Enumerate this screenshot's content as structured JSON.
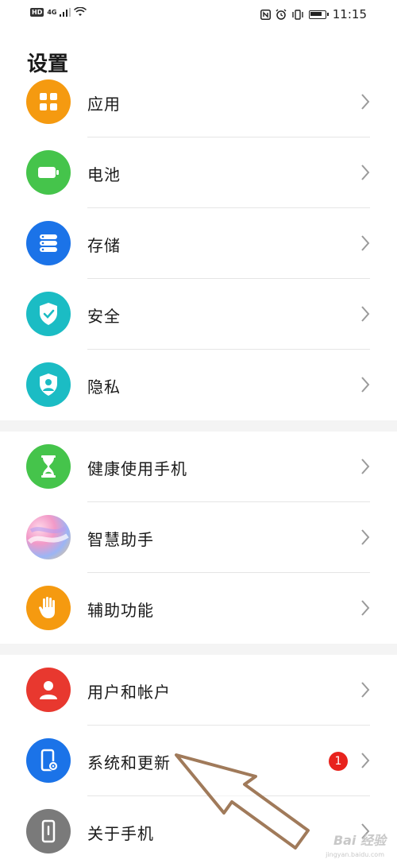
{
  "status_bar": {
    "left_hd": "HD",
    "left_network": "4G",
    "time": "11:15"
  },
  "page": {
    "title": "设置"
  },
  "groups": [
    {
      "items": [
        {
          "label": "应用",
          "icon": "apps-icon",
          "color": "#f59a10"
        },
        {
          "label": "电池",
          "icon": "battery-icon",
          "color": "#45c44b"
        },
        {
          "label": "存储",
          "icon": "storage-icon",
          "color": "#1b73e8"
        },
        {
          "label": "安全",
          "icon": "shield-check-icon",
          "color": "#1bbcc4"
        },
        {
          "label": "隐私",
          "icon": "privacy-shield-icon",
          "color": "#1bbcc4"
        }
      ]
    },
    {
      "items": [
        {
          "label": "健康使用手机",
          "icon": "hourglass-icon",
          "color": "#45c44b"
        },
        {
          "label": "智慧助手",
          "icon": "assistant-icon",
          "color": "gradient"
        },
        {
          "label": "辅助功能",
          "icon": "hand-icon",
          "color": "#f59a10"
        }
      ]
    },
    {
      "items": [
        {
          "label": "用户和帐户",
          "icon": "user-icon",
          "color": "#e8382f"
        },
        {
          "label": "系统和更新",
          "icon": "phone-gear-icon",
          "color": "#1b73e8",
          "badge": "1"
        },
        {
          "label": "关于手机",
          "icon": "phone-info-icon",
          "color": "#7a7a7a"
        }
      ]
    }
  ],
  "watermark": {
    "text": "Bai 经验",
    "sub": "jingyan.baidu.com"
  }
}
